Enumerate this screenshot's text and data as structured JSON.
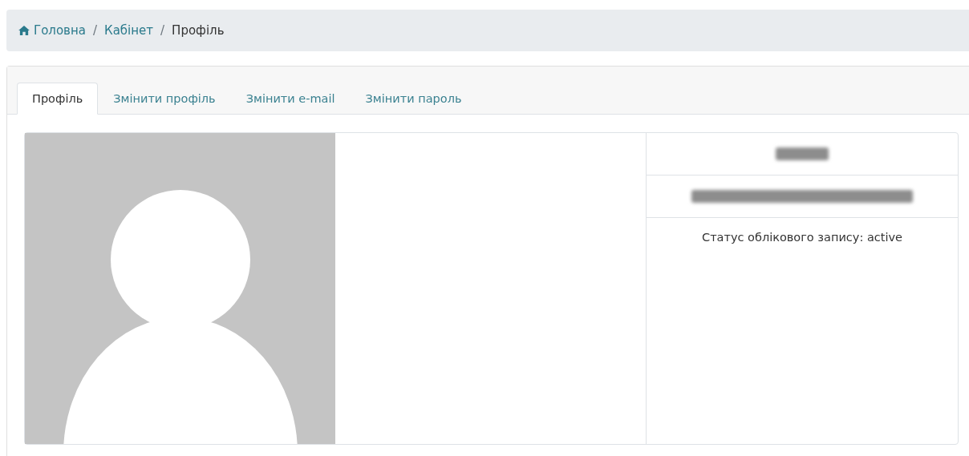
{
  "breadcrumb_separator": "/",
  "breadcrumb": [
    {
      "label": "Головна",
      "kind": "home"
    },
    {
      "label": "Кабінет",
      "kind": "link"
    },
    {
      "label": "Профіль",
      "kind": "current"
    }
  ],
  "tabs": [
    {
      "label": "Профіль",
      "selected": true
    },
    {
      "label": "Змінити профіль",
      "selected": false
    },
    {
      "label": "Змінити e-mail",
      "selected": false
    },
    {
      "label": "Змінити пароль",
      "selected": false
    }
  ],
  "profile": {
    "avatar": {
      "kind": "placeholder"
    },
    "details": [
      {
        "kind": "redacted-short"
      },
      {
        "kind": "redacted-long"
      },
      {
        "kind": "text",
        "text": "Статус облікового запису: active"
      }
    ]
  }
}
